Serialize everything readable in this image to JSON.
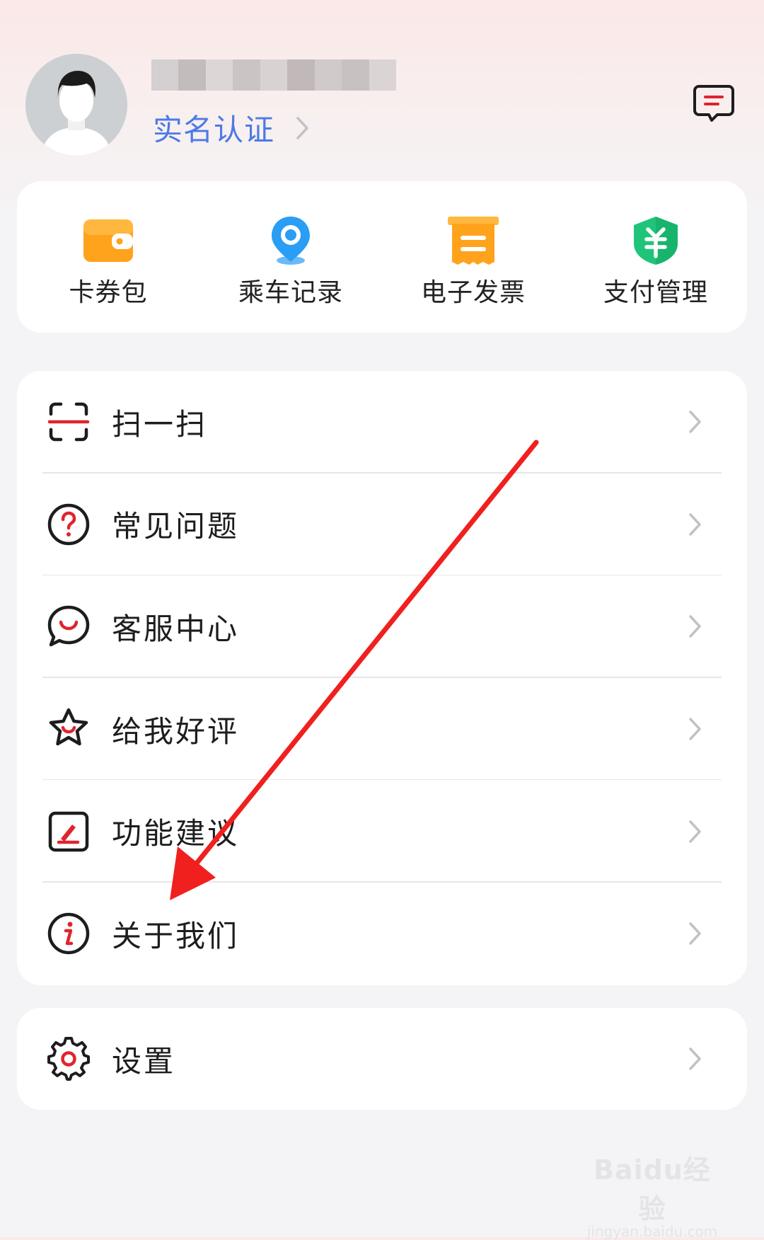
{
  "profile": {
    "verify_label": "实名认证"
  },
  "quick_actions": [
    {
      "label": "卡券包",
      "icon": "wallet-icon",
      "color": "#ffa21c"
    },
    {
      "label": "乘车记录",
      "icon": "location-pin-icon",
      "color": "#2a9df4"
    },
    {
      "label": "电子发票",
      "icon": "invoice-icon",
      "color": "#ffa21c"
    },
    {
      "label": "支付管理",
      "icon": "yuan-shield-icon",
      "color": "#1fc47a"
    }
  ],
  "menu": [
    {
      "label": "扫一扫",
      "icon": "scan-icon"
    },
    {
      "label": "常见问题",
      "icon": "question-icon"
    },
    {
      "label": "客服中心",
      "icon": "chat-service-icon"
    },
    {
      "label": "给我好评",
      "icon": "star-icon"
    },
    {
      "label": "功能建议",
      "icon": "edit-icon"
    },
    {
      "label": "关于我们",
      "icon": "info-icon"
    }
  ],
  "settings": {
    "label": "设置",
    "icon": "gear-icon"
  },
  "watermark": {
    "logo": "Baidu经验",
    "sub": "jingyan.baidu.com"
  },
  "colors": {
    "accent_red": "#e0242e",
    "link_blue": "#4c7ae6",
    "arrow_red": "#f0201e"
  }
}
